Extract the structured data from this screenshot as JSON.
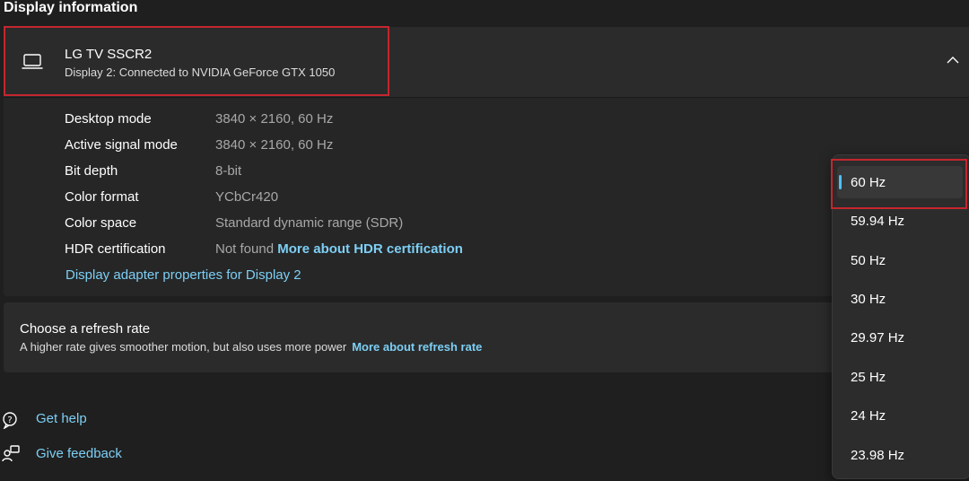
{
  "section_title": "Display information",
  "display": {
    "name": "LG TV SSCR2",
    "subtitle": "Display 2: Connected to NVIDIA GeForce GTX 1050",
    "details": [
      {
        "label": "Desktop mode",
        "value": "3840 × 2160, 60 Hz"
      },
      {
        "label": "Active signal mode",
        "value": "3840 × 2160, 60 Hz"
      },
      {
        "label": "Bit depth",
        "value": "8-bit"
      },
      {
        "label": "Color format",
        "value": "YCbCr420"
      },
      {
        "label": "Color space",
        "value": "Standard dynamic range (SDR)"
      },
      {
        "label": "HDR certification",
        "value": "Not found",
        "link": "More about HDR certification"
      }
    ],
    "adapter_link": "Display adapter properties for Display 2"
  },
  "refresh": {
    "title": "Choose a refresh rate",
    "description": "A higher rate gives smoother motion, but also uses more power",
    "link": "More about refresh rate"
  },
  "help": {
    "get_help": "Get help",
    "give_feedback": "Give feedback"
  },
  "refresh_options": [
    "60 Hz",
    "59.94 Hz",
    "50 Hz",
    "30 Hz",
    "29.97 Hz",
    "25 Hz",
    "24 Hz",
    "23.98 Hz"
  ],
  "selected_refresh": "60 Hz",
  "colors": {
    "accent": "#4cc2ff",
    "link": "#7dcff5",
    "highlight": "#c4262e"
  }
}
